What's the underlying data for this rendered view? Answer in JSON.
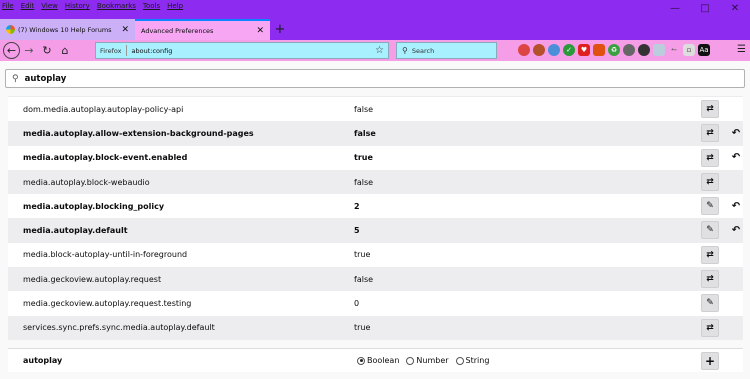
{
  "menubar": [
    "File",
    "Edit",
    "View",
    "History",
    "Bookmarks",
    "Tools",
    "Help"
  ],
  "tabs": [
    {
      "label": "(7) Windows 10 Help Forums"
    },
    {
      "label": "Advanced Preferences"
    }
  ],
  "navbar": {
    "identity": "Firefox",
    "url": "about:config",
    "search_placeholder": "Search"
  },
  "config_search": {
    "value": "autoplay"
  },
  "prefs": [
    {
      "name": "dom.media.autoplay.autoplay-policy-api",
      "value": "false",
      "modified": false,
      "action": "toggle",
      "reset": false
    },
    {
      "name": "media.autoplay.allow-extension-background-pages",
      "value": "false",
      "modified": true,
      "action": "toggle",
      "reset": true
    },
    {
      "name": "media.autoplay.block-event.enabled",
      "value": "true",
      "modified": true,
      "action": "toggle",
      "reset": true
    },
    {
      "name": "media.autoplay.block-webaudio",
      "value": "false",
      "modified": false,
      "action": "toggle",
      "reset": false
    },
    {
      "name": "media.autoplay.blocking_policy",
      "value": "2",
      "modified": true,
      "action": "edit",
      "reset": true
    },
    {
      "name": "media.autoplay.default",
      "value": "5",
      "modified": true,
      "action": "edit",
      "reset": true
    },
    {
      "name": "media.block-autoplay-until-in-foreground",
      "value": "true",
      "modified": false,
      "action": "toggle",
      "reset": false
    },
    {
      "name": "media.geckoview.autoplay.request",
      "value": "false",
      "modified": false,
      "action": "toggle",
      "reset": false
    },
    {
      "name": "media.geckoview.autoplay.request.testing",
      "value": "0",
      "modified": false,
      "action": "edit",
      "reset": false
    },
    {
      "name": "services.sync.prefs.sync.media.autoplay.default",
      "value": "true",
      "modified": false,
      "action": "toggle",
      "reset": false
    }
  ],
  "add_row": {
    "name": "autoplay",
    "types": [
      {
        "label": "Boolean",
        "checked": true
      },
      {
        "label": "Number",
        "checked": false
      },
      {
        "label": "String",
        "checked": false
      }
    ]
  }
}
